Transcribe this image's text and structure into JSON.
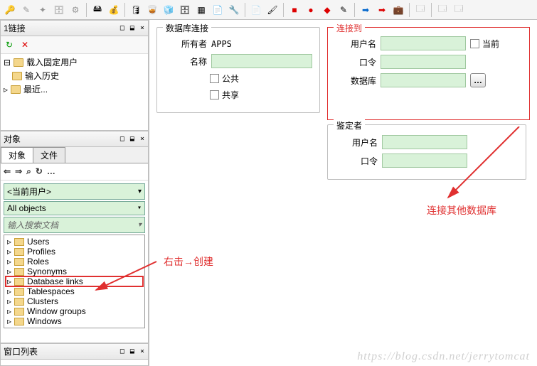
{
  "toolbar_icons": [
    "key",
    "edit",
    "sparkle",
    "db",
    "gear",
    "sep",
    "disk",
    "money",
    "sep",
    "db-down",
    "barrel",
    "cup",
    "db",
    "grid",
    "doc",
    "wrench",
    "sep",
    "doc2",
    "brush",
    "sep",
    "red",
    "red2",
    "red3",
    "brush2",
    "sep",
    "arr-blue",
    "arr-red",
    "case",
    "sep",
    "win",
    "sep",
    "win2",
    "sep"
  ],
  "left": {
    "panel1": {
      "title": "1链接",
      "ctrls": "□ ⬓ ×",
      "tree": [
        {
          "label": "载入固定用户"
        },
        {
          "label": "输入历史"
        },
        {
          "label": "最近..."
        }
      ]
    },
    "panel2": {
      "title": "对象",
      "ctrls": "□ ⬓ ×",
      "tabs": [
        "对象",
        "文件"
      ],
      "dd_user": "<当前用户>",
      "dd_filter": "All objects",
      "search_placeholder": "输入搜索文档",
      "items": [
        "Users",
        "Profiles",
        "Roles",
        "Synonyms",
        "Database links",
        "Tablespaces",
        "Clusters",
        "Window groups",
        "Windows"
      ],
      "selected_index": 4
    },
    "panel3": {
      "title": "窗口列表",
      "ctrls": "□ ⬓ ×"
    }
  },
  "right": {
    "db_conn": {
      "title": "数据库连接",
      "owner_label": "所有者",
      "owner_value": "APPS",
      "name_label": "名称",
      "public_label": "公共",
      "shared_label": "共享"
    },
    "connect_to": {
      "title": "连接到",
      "user_label": "用户名",
      "pwd_label": "口令",
      "db_label": "数据库",
      "current_label": "当前"
    },
    "authenticator": {
      "title": "鉴定者",
      "user_label": "用户名",
      "pwd_label": "口令"
    }
  },
  "annotations": {
    "right_click": "右击→创建",
    "connect_other": "连接其他数据库"
  },
  "watermark": "https://blog.csdn.net/jerrytomcat"
}
